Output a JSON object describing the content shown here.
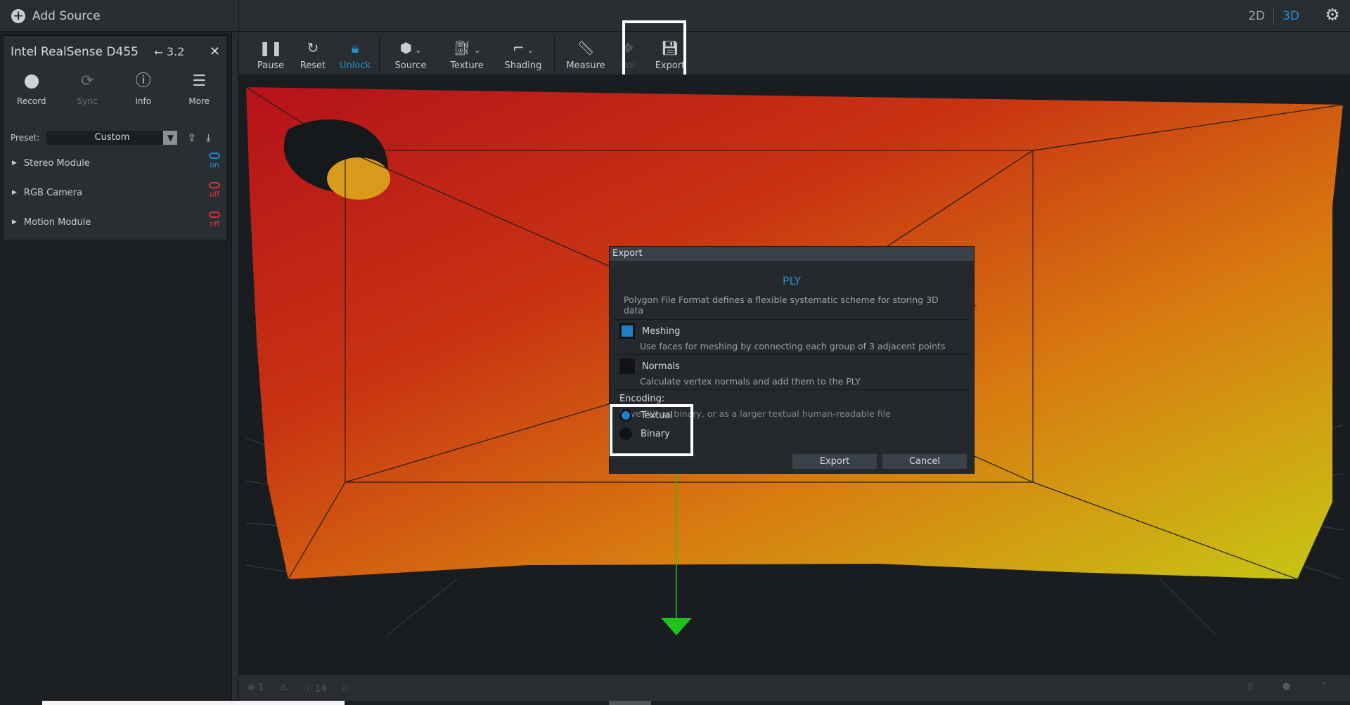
{
  "topbar": {
    "add_source": "Add Source",
    "view_2d": "2D",
    "view_3d": "3D"
  },
  "device": {
    "name": "Intel RealSense D455",
    "usb": "3.2",
    "actions": [
      {
        "label": "Record",
        "icon": "record-icon"
      },
      {
        "label": "Sync",
        "icon": "sync-icon"
      },
      {
        "label": "Info",
        "icon": "info-icon"
      },
      {
        "label": "More",
        "icon": "menu-icon"
      }
    ],
    "preset_label": "Preset:",
    "preset_value": "Custom",
    "modules": [
      {
        "label": "Stereo Module",
        "state": "on"
      },
      {
        "label": "RGB Camera",
        "state": "off"
      },
      {
        "label": "Motion Module",
        "state": "off"
      }
    ]
  },
  "toolbar": {
    "pause": "Pause",
    "reset": "Reset",
    "unlock": "Unlock",
    "source": "Source",
    "texture": "Texture",
    "shading": "Shading",
    "measure": "Measure",
    "roi": "Roi",
    "export": "Export"
  },
  "dialog": {
    "title": "Export",
    "heading": "PLY",
    "description": "Polygon File Format defines a flexible systematic scheme for storing 3D data",
    "meshing": {
      "label": "Meshing",
      "desc": "Use faces for meshing by connecting each group of 3 adjacent points",
      "checked": true
    },
    "normals": {
      "label": "Normals",
      "desc": "Calculate vertex normals and add them to the PLY",
      "checked": false
    },
    "encoding_label": "Encoding:",
    "encoding_desc": "Save PLY as binary, or as a larger textual human-readable file",
    "encoding_options": [
      {
        "label": "Textual",
        "selected": true
      },
      {
        "label": "Binary",
        "selected": false
      }
    ],
    "export_button": "Export",
    "cancel_button": "Cancel"
  },
  "status": {
    "errors": "1",
    "info": "14"
  },
  "colors": {
    "accent": "#1e8ed0",
    "off": "#d0343c",
    "panel": "#2a2e32",
    "background": "#1c2023"
  }
}
